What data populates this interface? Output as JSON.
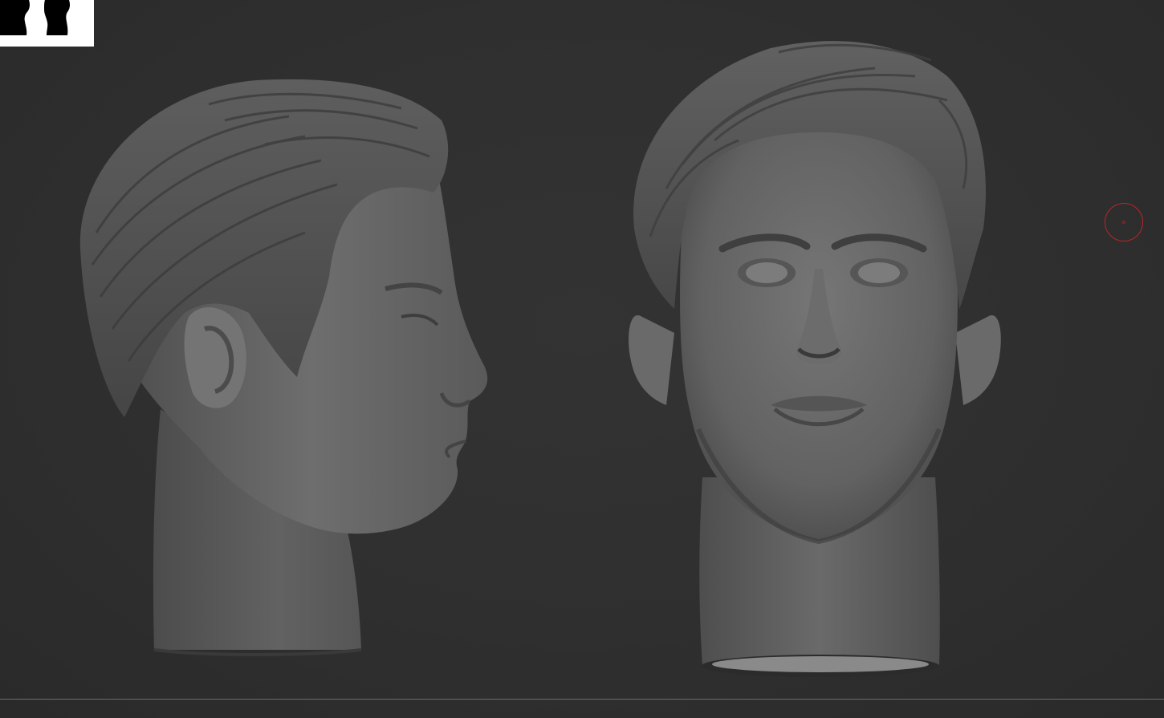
{
  "canvas": {
    "background_color": "#2e2e2e",
    "sculpt_color": "#6e6e6e",
    "floor_line_color": "#6c6c6c"
  },
  "navigator_thumbnail": {
    "icon": "head-silhouettes-icon",
    "background_color": "#ffffff",
    "figure_color": "#000000"
  },
  "models": [
    {
      "view": "side-profile",
      "icon": "head-sculpt-side-view"
    },
    {
      "view": "front",
      "icon": "head-sculpt-front-view"
    }
  ],
  "cursor": {
    "icon": "brush-cursor-ring-icon",
    "color": "#b8262a"
  }
}
